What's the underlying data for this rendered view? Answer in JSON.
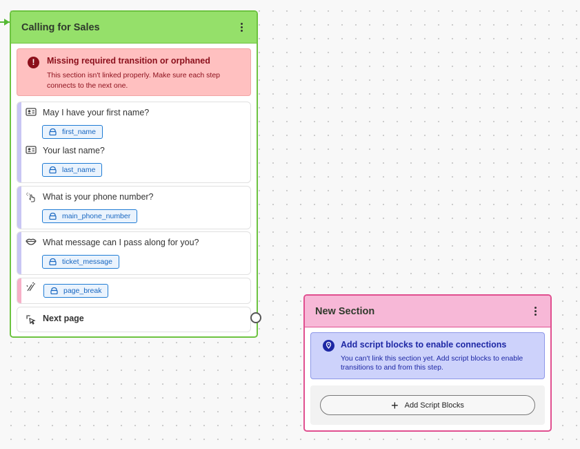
{
  "sections": {
    "calling": {
      "title": "Calling for Sales",
      "alert": {
        "title": "Missing required transition or orphaned",
        "body": "This section isn't linked properly. Make sure each step connects to the next one."
      },
      "blocks": [
        {
          "icon": "contact-card-icon",
          "question": "May I have your first name?",
          "variable": "first_name"
        },
        {
          "icon": "contact-card-icon",
          "question": "Your last name?",
          "variable": "last_name"
        },
        {
          "icon": "tap-gesture-icon",
          "question": "What is your phone number?",
          "variable": "main_phone_number"
        },
        {
          "icon": "speech-lips-icon",
          "question": "What message can I pass along for you?",
          "variable": "ticket_message"
        },
        {
          "icon": "page-break-icon",
          "variable": "page_break"
        }
      ],
      "next_page": {
        "icon": "click-pointer-icon",
        "label": "Next page"
      }
    },
    "new_section": {
      "title": "New Section",
      "alert": {
        "title": "Add script blocks to enable connections",
        "body": "You can't link this section yet. Add script blocks to enable transitions to and from this step."
      },
      "add_button": {
        "icon": "plus-icon",
        "label": "Add Script Blocks"
      }
    }
  },
  "colors": {
    "calling_header": "#95e06a",
    "calling_border": "#6cc33f",
    "new_section_header": "#f7b8d7",
    "new_section_border": "#e04e8f",
    "error_bg": "#ffc0c0",
    "error_text": "#8b0f1b",
    "info_bg": "#cdd2fb",
    "info_text": "#1d27a4",
    "chip_border": "#1e7bd4"
  }
}
